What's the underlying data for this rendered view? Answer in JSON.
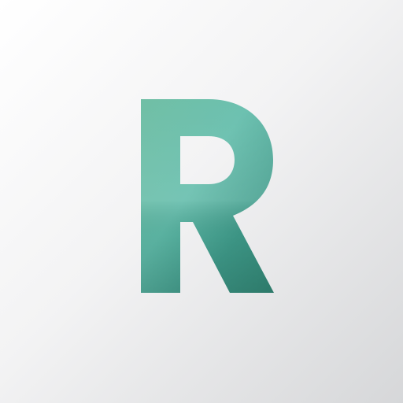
{
  "app_icon": {
    "letter": "R",
    "icon_name": "letter-r-logo-icon",
    "colors": {
      "background_light": "#ffffff",
      "background_mid": "#f3f3f4",
      "background_dark": "#d6d7d9",
      "letter_top": "#64b99d",
      "letter_mid": "#5fbba9",
      "letter_bottom": "#338a78",
      "letter_right": "#35a08f"
    }
  }
}
